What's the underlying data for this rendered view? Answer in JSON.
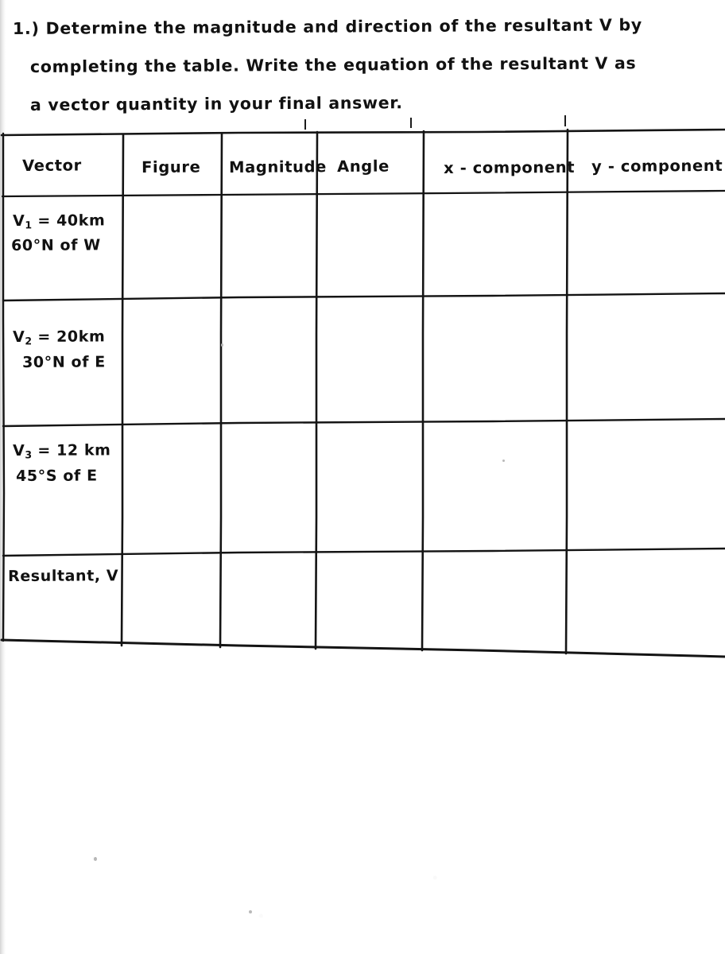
{
  "document": {
    "kind": "handwritten-worksheet",
    "ink_color": "#111111",
    "paper_color": "#ffffff"
  },
  "question": {
    "number": "1.)",
    "lines": [
      "1.) Determine the magnitude and direction of the resultant V by",
      "completing the table. Write the equation of the resultant V as",
      "a vector quantity in your final answer."
    ]
  },
  "table": {
    "headers": [
      "Vector",
      "Figure",
      "Magnitude",
      "Angle",
      "x - component",
      "y - component"
    ],
    "rows": [
      {
        "vector_label": "V",
        "vector_subscript": "1",
        "magnitude_text": "= 40km",
        "direction_text": "60°N of W",
        "figure": "",
        "magnitude": "",
        "angle": "",
        "x_component": "",
        "y_component": ""
      },
      {
        "vector_label": "V",
        "vector_subscript": "2",
        "magnitude_text": "= 20km",
        "direction_text": "30°N of E",
        "figure": "",
        "magnitude": "",
        "angle": "",
        "x_component": "",
        "y_component": ""
      },
      {
        "vector_label": "V",
        "vector_subscript": "3",
        "magnitude_text": "= 12 km",
        "direction_text": "45°S of E",
        "figure": "",
        "magnitude": "",
        "angle": "",
        "x_component": "",
        "y_component": ""
      },
      {
        "vector_label": "Resultant, V",
        "vector_subscript": "",
        "magnitude_text": "",
        "direction_text": "",
        "figure": "",
        "magnitude": "",
        "angle": "",
        "x_component": "",
        "y_component": ""
      }
    ]
  }
}
